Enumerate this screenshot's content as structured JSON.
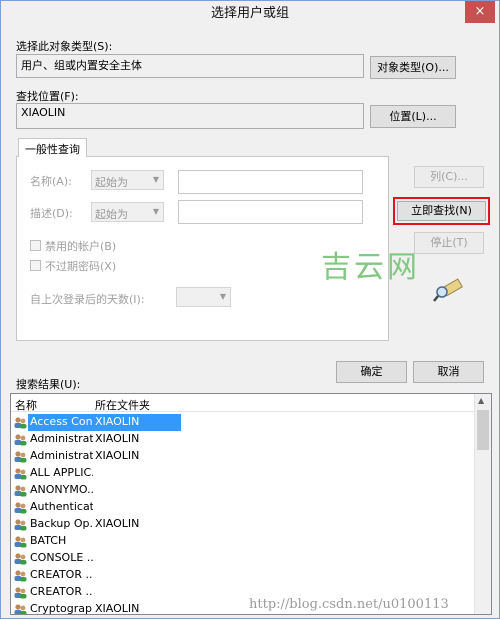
{
  "window": {
    "title": "选择用户或组",
    "close_glyph": "×"
  },
  "object_type": {
    "label": "选择此对象类型(S):",
    "value": "用户、组或内置安全主体",
    "button": "对象类型(O)..."
  },
  "location": {
    "label": "查找位置(F):",
    "value": "XIAOLIN",
    "button": "位置(L)..."
  },
  "tab": {
    "label": "一般性查询"
  },
  "query": {
    "name_label": "名称(A):",
    "name_select": "起始为",
    "desc_label": "描述(D):",
    "desc_select": "起始为",
    "disabled_accounts": "禁用的帐户(B)",
    "non_expiring": "不过期密码(X)",
    "days_label": "自上次登录后的天数(I):"
  },
  "buttons": {
    "columns": "列(C)...",
    "find_now": "立即查找(N)",
    "stop": "停止(T)",
    "ok": "确定",
    "cancel": "取消"
  },
  "results": {
    "label": "搜索结果(U):",
    "columns": [
      "名称",
      "所在文件夹"
    ],
    "rows": [
      {
        "name": "Access Con...",
        "folder": "XIAOLIN",
        "selected": true
      },
      {
        "name": "Administrat...",
        "folder": "XIAOLIN"
      },
      {
        "name": "Administrat...",
        "folder": "XIAOLIN"
      },
      {
        "name": "ALL APPLIC...",
        "folder": ""
      },
      {
        "name": "ANONYMO...",
        "folder": ""
      },
      {
        "name": "Authenticat...",
        "folder": ""
      },
      {
        "name": "Backup Op...",
        "folder": "XIAOLIN"
      },
      {
        "name": "BATCH",
        "folder": ""
      },
      {
        "name": "CONSOLE ...",
        "folder": ""
      },
      {
        "name": "CREATOR ...",
        "folder": ""
      },
      {
        "name": "CREATOR ...",
        "folder": ""
      },
      {
        "name": "Cryptograp...",
        "folder": "XIAOLIN"
      }
    ]
  },
  "watermarks": {
    "brand": "吉云网",
    "url": "http://blog.csdn.net/u0100113"
  },
  "colors": {
    "highlight": "#3399ff",
    "find_outline": "#e0141e"
  }
}
